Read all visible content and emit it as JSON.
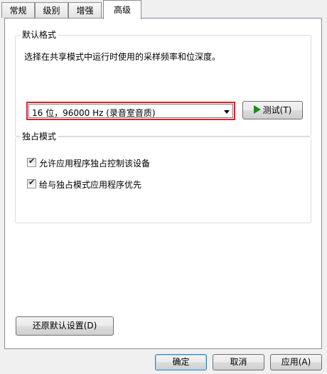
{
  "tabs": [
    {
      "label": "常规"
    },
    {
      "label": "级别"
    },
    {
      "label": "增强"
    },
    {
      "label": "高级"
    }
  ],
  "default_format": {
    "title": "默认格式",
    "description": "选择在共享模式中运行时使用的采样频率和位深度。",
    "selected_value": "16 位，96000 Hz (录音室音质)",
    "test_button": "测试(T)",
    "highlight_color": "#d7232a"
  },
  "exclusive_mode": {
    "title": "独占模式",
    "options": [
      {
        "label": "允许应用程序独占控制该设备",
        "checked": true
      },
      {
        "label": "给与独占模式应用程序优先",
        "checked": true
      }
    ]
  },
  "restore_button": "还原默认设置(D)",
  "footer": {
    "ok": "确定",
    "cancel": "取消",
    "apply": "应用(A)"
  }
}
